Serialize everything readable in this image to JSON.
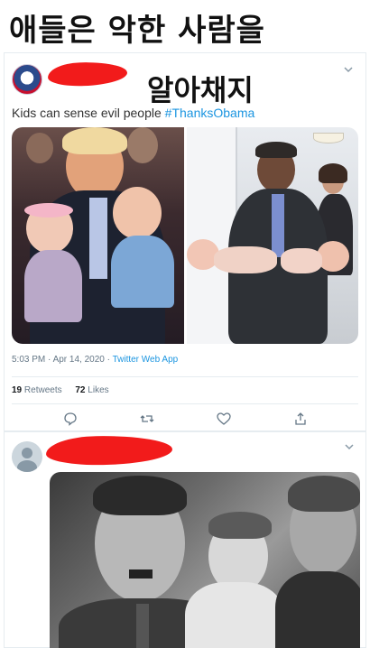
{
  "caption": {
    "top": "애들은 악한 사람을",
    "overlay": "알아채지"
  },
  "tweet1": {
    "text_plain": "Kids can sense evil people ",
    "hashtag": "#ThanksObama",
    "timestamp": "5:03 PM · Apr 14, 2020 · ",
    "source": "Twitter Web App",
    "retweets_count": "19",
    "retweets_label": "Retweets",
    "likes_count": "72",
    "likes_label": "Likes"
  },
  "colors": {
    "redaction": "#f21b1b",
    "link": "#1b95e0",
    "muted": "#657786"
  },
  "icons": {
    "reply": "reply-icon",
    "retweet": "retweet-icon",
    "like": "heart-icon",
    "share": "share-icon",
    "more": "chevron-down-icon"
  }
}
